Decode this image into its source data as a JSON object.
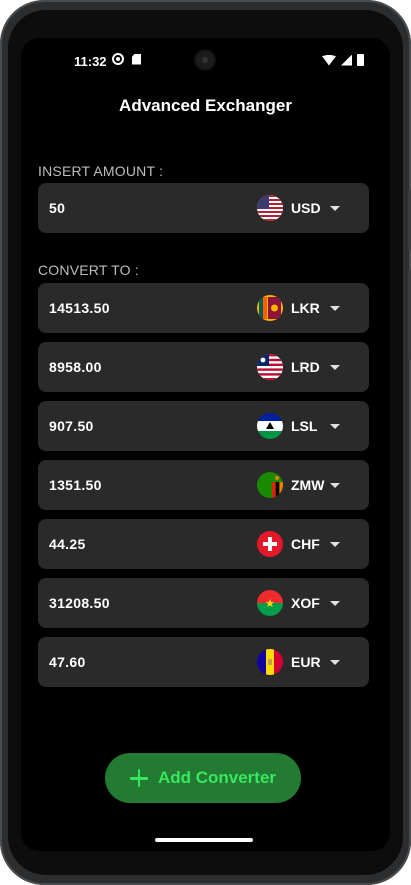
{
  "status_bar": {
    "time": "11:32",
    "left_icons": [
      "gear-icon",
      "sdcard-icon"
    ],
    "right_icons": [
      "wifi-icon",
      "signal-icon",
      "battery-icon"
    ]
  },
  "app": {
    "title": "Advanced Exchanger"
  },
  "insert_section": {
    "label": "INSERT AMOUNT :",
    "amount": "50",
    "currency": "USD",
    "flag": "flag-us"
  },
  "convert_section": {
    "label": "CONVERT TO :",
    "rows": [
      {
        "amount": "14513.50",
        "currency": "LKR",
        "flag": "flag-lk"
      },
      {
        "amount": "8958.00",
        "currency": "LRD",
        "flag": "flag-lr"
      },
      {
        "amount": "907.50",
        "currency": "LSL",
        "flag": "flag-ls"
      },
      {
        "amount": "1351.50",
        "currency": "ZMW",
        "flag": "flag-zm"
      },
      {
        "amount": "44.25",
        "currency": "CHF",
        "flag": "flag-ch"
      },
      {
        "amount": "31208.50",
        "currency": "XOF",
        "flag": "flag-bf"
      },
      {
        "amount": "47.60",
        "currency": "EUR",
        "flag": "flag-ad"
      }
    ]
  },
  "add_button": {
    "label": "Add Converter",
    "icon": "plus-icon"
  },
  "colors": {
    "background": "#000000",
    "card": "#2a2a2b",
    "accent": "#39e75f",
    "button_bg": "#237a32"
  }
}
